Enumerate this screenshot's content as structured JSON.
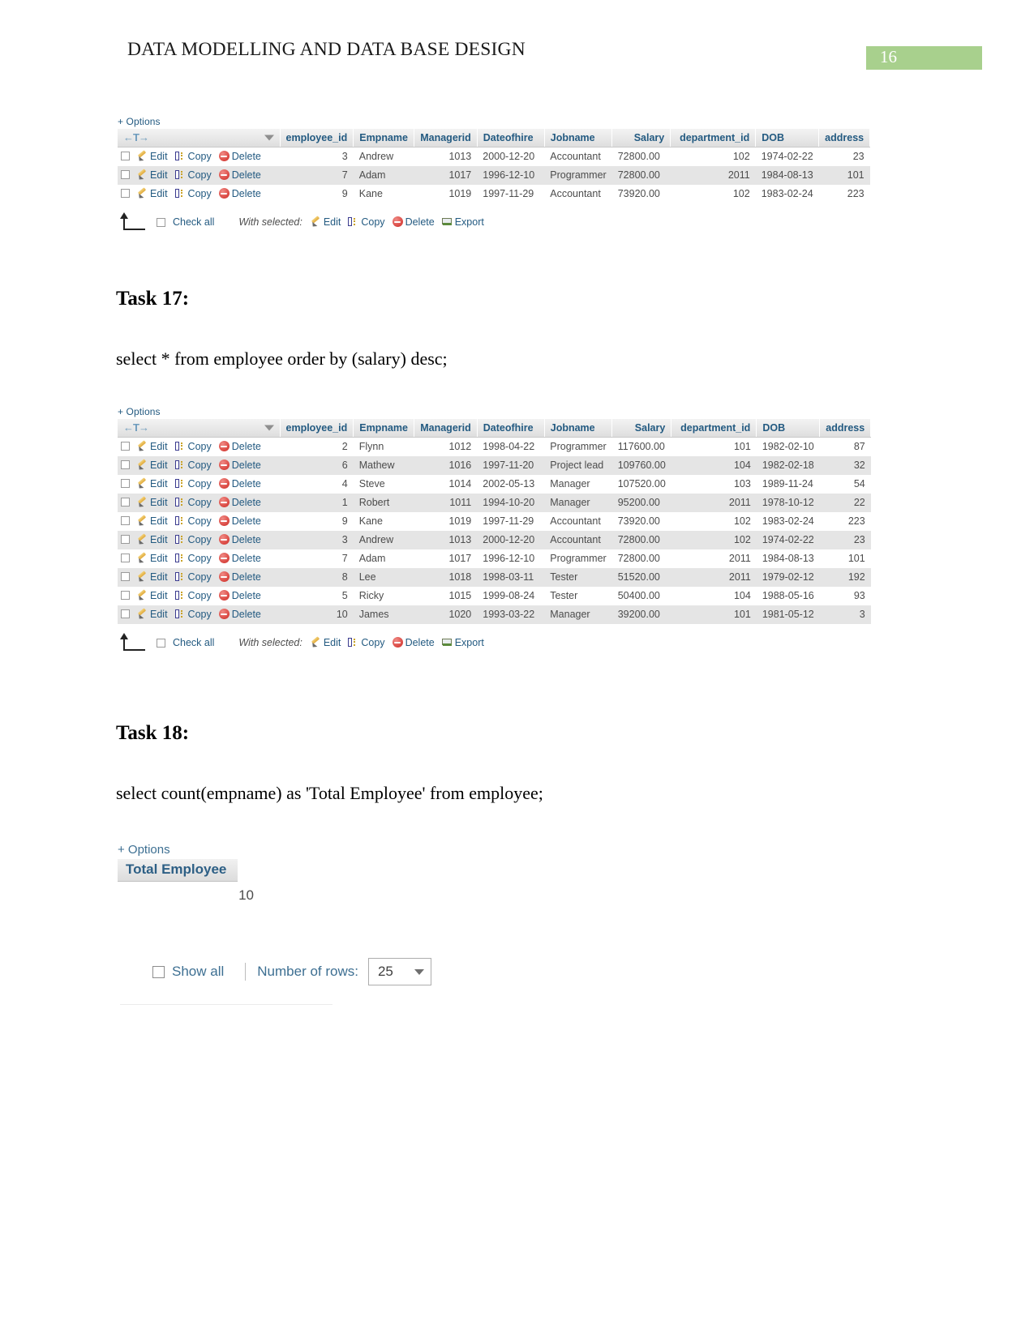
{
  "document": {
    "title": "DATA MODELLING AND DATA BASE DESIGN",
    "page_number": "16",
    "page_badge_color": "#a8d08d"
  },
  "common": {
    "options_label": "+ Options",
    "edit_label": "Edit",
    "copy_label": "Copy",
    "delete_label": "Delete",
    "export_label": "Export",
    "check_all_label": "Check all",
    "with_selected_label": "With selected:",
    "sort_nav": "←T→",
    "columns": [
      "employee_id",
      "Empname",
      "Managerid",
      "Dateofhire",
      "Jobname",
      "Salary",
      "department_id",
      "DOB",
      "address"
    ]
  },
  "result_top": {
    "rows": [
      {
        "employee_id": "3",
        "empname": "Andrew",
        "managerid": "1013",
        "dateofhire": "2000-12-20",
        "jobname": "Accountant",
        "salary": "72800.00",
        "department_id": "102",
        "dob": "1974-02-22",
        "address": "23"
      },
      {
        "employee_id": "7",
        "empname": "Adam",
        "managerid": "1017",
        "dateofhire": "1996-12-10",
        "jobname": "Programmer",
        "salary": "72800.00",
        "department_id": "2011",
        "dob": "1984-08-13",
        "address": "101"
      },
      {
        "employee_id": "9",
        "empname": "Kane",
        "managerid": "1019",
        "dateofhire": "1997-11-29",
        "jobname": "Accountant",
        "salary": "73920.00",
        "department_id": "102",
        "dob": "1983-02-24",
        "address": "223"
      }
    ]
  },
  "task17": {
    "heading": "Task 17:",
    "query": "select * from employee order by (salary) desc;",
    "rows": [
      {
        "employee_id": "2",
        "empname": "Flynn",
        "managerid": "1012",
        "dateofhire": "1998-04-22",
        "jobname": "Programmer",
        "salary": "117600.00",
        "department_id": "101",
        "dob": "1982-02-10",
        "address": "87"
      },
      {
        "employee_id": "6",
        "empname": "Mathew",
        "managerid": "1016",
        "dateofhire": "1997-11-20",
        "jobname": "Project lead",
        "salary": "109760.00",
        "department_id": "104",
        "dob": "1982-02-18",
        "address": "32"
      },
      {
        "employee_id": "4",
        "empname": "Steve",
        "managerid": "1014",
        "dateofhire": "2002-05-13",
        "jobname": "Manager",
        "salary": "107520.00",
        "department_id": "103",
        "dob": "1989-11-24",
        "address": "54"
      },
      {
        "employee_id": "1",
        "empname": "Robert",
        "managerid": "1011",
        "dateofhire": "1994-10-20",
        "jobname": "Manager",
        "salary": "95200.00",
        "department_id": "2011",
        "dob": "1978-10-12",
        "address": "22"
      },
      {
        "employee_id": "9",
        "empname": "Kane",
        "managerid": "1019",
        "dateofhire": "1997-11-29",
        "jobname": "Accountant",
        "salary": "73920.00",
        "department_id": "102",
        "dob": "1983-02-24",
        "address": "223"
      },
      {
        "employee_id": "3",
        "empname": "Andrew",
        "managerid": "1013",
        "dateofhire": "2000-12-20",
        "jobname": "Accountant",
        "salary": "72800.00",
        "department_id": "102",
        "dob": "1974-02-22",
        "address": "23"
      },
      {
        "employee_id": "7",
        "empname": "Adam",
        "managerid": "1017",
        "dateofhire": "1996-12-10",
        "jobname": "Programmer",
        "salary": "72800.00",
        "department_id": "2011",
        "dob": "1984-08-13",
        "address": "101"
      },
      {
        "employee_id": "8",
        "empname": "Lee",
        "managerid": "1018",
        "dateofhire": "1998-03-11",
        "jobname": "Tester",
        "salary": "51520.00",
        "department_id": "2011",
        "dob": "1979-02-12",
        "address": "192"
      },
      {
        "employee_id": "5",
        "empname": "Ricky",
        "managerid": "1015",
        "dateofhire": "1999-08-24",
        "jobname": "Tester",
        "salary": "50400.00",
        "department_id": "104",
        "dob": "1988-05-16",
        "address": "93"
      },
      {
        "employee_id": "10",
        "empname": "James",
        "managerid": "1020",
        "dateofhire": "1993-03-22",
        "jobname": "Manager",
        "salary": "39200.00",
        "department_id": "101",
        "dob": "1981-05-12",
        "address": "3"
      }
    ]
  },
  "task18": {
    "heading": "Task 18:",
    "query": "select count(empname) as 'Total Employee' from employee;",
    "options_label": "+ Options",
    "result_column": "Total Employee",
    "result_value": "10"
  },
  "rows_control": {
    "show_all_label": "Show all",
    "number_of_rows_label": "Number of rows:",
    "selected_rows": "25"
  }
}
